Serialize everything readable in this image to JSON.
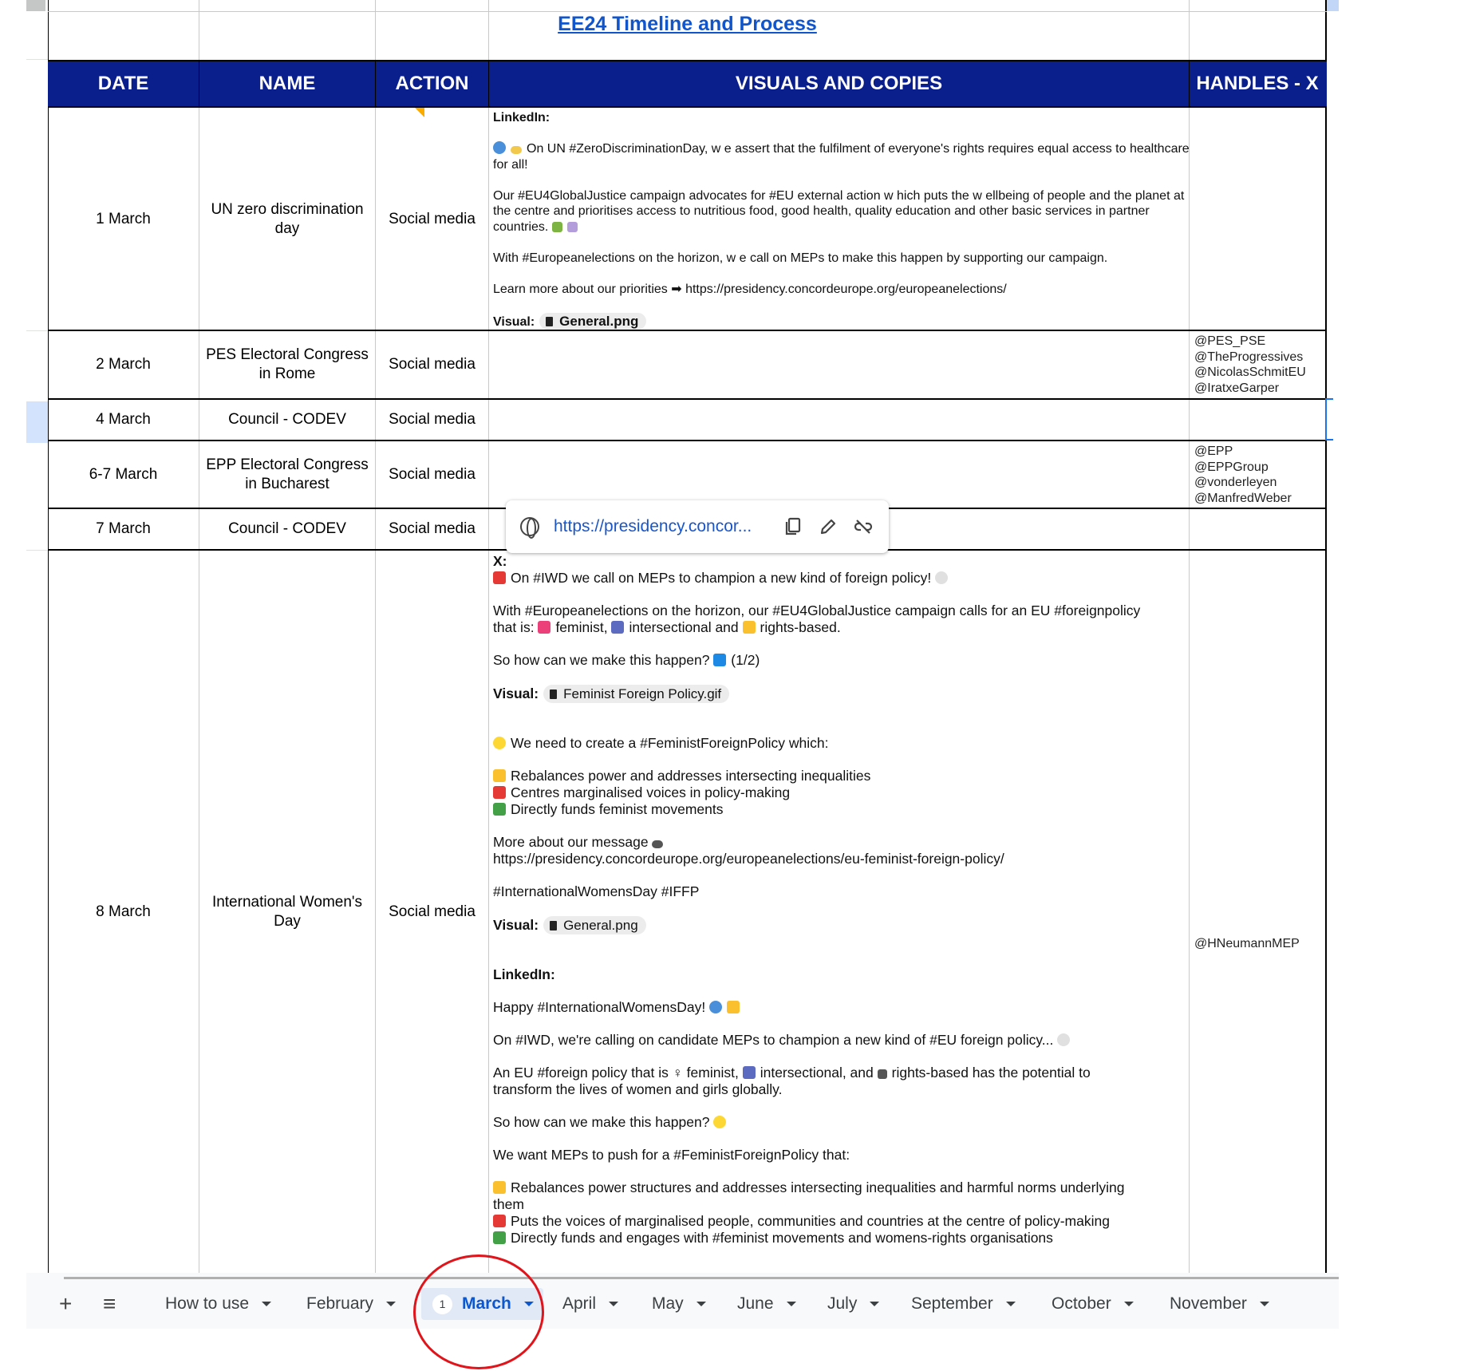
{
  "sheet": {
    "title": "EE24 Timeline and Process",
    "headers": {
      "date": "DATE",
      "name": "NAME",
      "action": "ACTION",
      "visuals": "VISUALS AND COPIES",
      "handles": "HANDLES - X"
    },
    "rows": [
      {
        "date": "1 March",
        "name": "UN zero discrimination day",
        "action": "Social media",
        "handles": []
      },
      {
        "date": "2 March",
        "name": "PES Electoral Congress in Rome",
        "action": "Social media",
        "handles": [
          "@PES_PSE",
          "@TheProgressives",
          "@NicolasSchmitEU",
          "@IratxeGarper"
        ]
      },
      {
        "date": "4 March",
        "name": "Council - CODEV",
        "action": "Social media",
        "handles": []
      },
      {
        "date": "6-7 March",
        "name": "EPP Electoral Congress in Bucharest",
        "action": "Social media",
        "handles": [
          "@EPP",
          "@EPPGroup",
          "@vonderleyen",
          "@ManfredWeber"
        ]
      },
      {
        "date": "7 March",
        "name": "Council - CODEV",
        "action": "Social media",
        "handles": []
      },
      {
        "date": "8 March",
        "name": "International Women's Day",
        "action": "Social media",
        "handles": [
          "@HNeumannMEP"
        ]
      }
    ],
    "row1_visuals": {
      "platform": "LinkedIn:",
      "p1": "On UN #ZeroDiscriminationDay, w e assert that the fulfilment of everyone's rights requires equal access to healthcare for all!",
      "p2": "Our #EU4GlobalJustice campaign advocates for #EU external action w hich puts the w ellbeing of people and the planet at the centre and prioritises access to nutritious food, good health, quality education and other basic services in partner countries.",
      "p3": "With #Europeanelections on the horizon, w e call on MEPs to make this happen by supporting our campaign.",
      "p4": "Learn more about our priorities ➡ https://presidency.concordeurope.org/europeanelections/",
      "visual_label": "Visual:",
      "visual_file": "General.png"
    },
    "row6_visuals": {
      "x_label": "X:",
      "x1": "On #IWD we call on MEPs to champion a new kind of foreign policy!",
      "x2a": "With #Europeanelections on the horizon, our #EU4GlobalJustice campaign calls for an EU #foreignpolicy",
      "x2b_1": "that is:",
      "x2b_2": "feminist,",
      "x2b_3": "intersectional and",
      "x2b_4": "rights-based.",
      "x3": "So how can we make this happen?",
      "x3_suffix": "(1/2)",
      "visual_label": "Visual:",
      "visual_file_1": "Feminist Foreign Policy.gif",
      "x4": "We need to create a #FeministForeignPolicy which:",
      "x5": "Rebalances power and addresses intersecting inequalities",
      "x6": "Centres marginalised voices in policy-making",
      "x7": "Directly funds feminist movements",
      "x8": "More about our message",
      "x9": "https://presidency.concordeurope.org/europeanelections/eu-feminist-foreign-policy/",
      "x10": "#InternationalWomensDay #IFFP",
      "visual_file_2": "General.png",
      "li_label": "LinkedIn:",
      "l1": "Happy #InternationalWomensDay!",
      "l2": "On #IWD, we're calling on candidate MEPs to champion a new kind of #EU foreign policy...",
      "l3a": "An EU #foreign policy that is ♀ feminist,",
      "l3b": "intersectional, and",
      "l3c": "rights-based has the potential to",
      "l3d": "transform the lives of women and girls globally.",
      "l4": "So how can we make this happen?",
      "l5": "We want MEPs to push for a #FeministForeignPolicy that:",
      "l6": "Rebalances power structures and addresses intersecting inequalities and harmful norms underlying",
      "l6b": "them",
      "l7": "Puts the voices of marginalised people, communities and countries at the centre of policy-making",
      "l8": "Directly funds and engages with #feminist movements and womens-rights organisations"
    }
  },
  "link_popup": {
    "url": "https://presidency.concor..."
  },
  "tabs": {
    "add_icon": "+",
    "menu_icon": "≡",
    "items": [
      "How to use",
      "February",
      "March",
      "April",
      "May",
      "June",
      "July",
      "September",
      "October",
      "November"
    ],
    "active": "March",
    "active_badge": "1"
  },
  "colors": {
    "header_bg": "#0b1f8c",
    "link": "#1155cc",
    "active_tab": "#0b57d0",
    "annotation": "#e0141a"
  }
}
